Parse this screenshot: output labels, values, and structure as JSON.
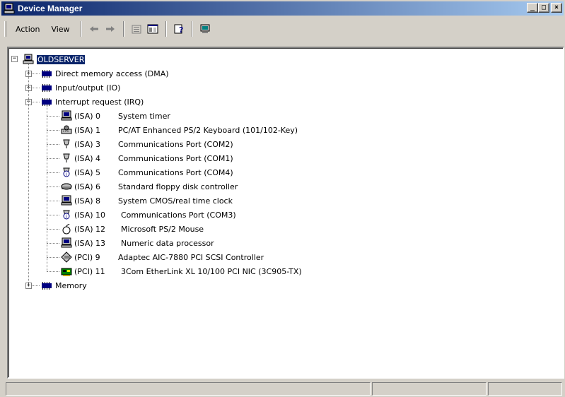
{
  "window": {
    "title": "Device Manager"
  },
  "window_buttons": {
    "minimize": "_",
    "maximize": "□",
    "close": "×"
  },
  "menu": {
    "action": "Action",
    "view": "View"
  },
  "toolbar": {
    "buttons": [
      "back-arrow-icon",
      "forward-arrow-icon",
      "properties-icon",
      "show-hide-console-tree-icon",
      "help-icon",
      "computer-icon"
    ]
  },
  "tree": {
    "root": "OLDSERVER",
    "categories": [
      {
        "label": "Direct memory access (DMA)",
        "expanded": false
      },
      {
        "label": "Input/output (IO)",
        "expanded": false
      },
      {
        "label": "Interrupt request (IRQ)",
        "expanded": true
      },
      {
        "label": "Memory",
        "expanded": false
      }
    ],
    "irq_items": [
      {
        "bus": "(ISA) 0",
        "name": "System timer",
        "icon": "system-device-icon"
      },
      {
        "bus": "(ISA) 1",
        "name": "PC/AT Enhanced PS/2 Keyboard (101/102-Key)",
        "icon": "keyboard-icon"
      },
      {
        "bus": "(ISA) 3",
        "name": "Communications Port (COM2)",
        "icon": "port-icon"
      },
      {
        "bus": "(ISA) 4",
        "name": "Communications Port (COM1)",
        "icon": "port-icon"
      },
      {
        "bus": "(ISA) 5",
        "name": "Communications Port (COM4)",
        "icon": "port-warning-icon"
      },
      {
        "bus": "(ISA) 6",
        "name": "Standard floppy disk controller",
        "icon": "floppy-controller-icon"
      },
      {
        "bus": "(ISA) 8",
        "name": "System CMOS/real time clock",
        "icon": "system-device-icon"
      },
      {
        "bus": "(ISA) 10",
        "name": "Communications Port (COM3)",
        "icon": "port-warning-icon"
      },
      {
        "bus": "(ISA) 12",
        "name": "Microsoft PS/2 Mouse",
        "icon": "mouse-icon"
      },
      {
        "bus": "(ISA) 13",
        "name": "Numeric data processor",
        "icon": "system-device-icon"
      },
      {
        "bus": "(PCI) 9",
        "name": "Adaptec AIC-7880 PCI SCSI Controller",
        "icon": "scsi-controller-icon"
      },
      {
        "bus": "(PCI) 11",
        "name": "3Com EtherLink XL 10/100 PCI NIC (3C905-TX)",
        "icon": "network-adapter-icon"
      }
    ]
  },
  "colors": {
    "selection": "#0a246a",
    "titlebar_start": "#0a246a",
    "titlebar_end": "#a6caf0",
    "face": "#d4d0c8"
  }
}
